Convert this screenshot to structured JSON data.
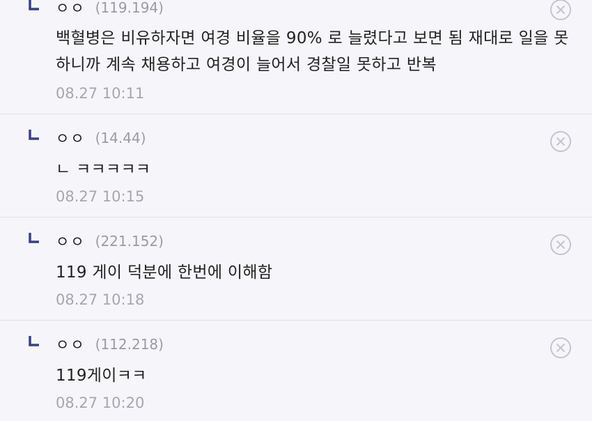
{
  "replies": [
    {
      "nick": "ㅇㅇ",
      "ip": "(119.194)",
      "text": "백혈병은 비유하자면 여경 비율을 90% 로 늘렸다고 보면 됨 재대로 일을 못하니까 계속 채용하고 여경이 늘어서 경찰일 못하고 반복",
      "time": "08.27 10:11"
    },
    {
      "nick": "ㅇㅇ",
      "ip": "(14.44)",
      "text": "ㄴ ㅋㅋㅋㅋㅋ",
      "time": "08.27 10:15"
    },
    {
      "nick": "ㅇㅇ",
      "ip": "(221.152)",
      "text": "119 게이 덕분에 한번에 이해함",
      "time": "08.27 10:18"
    },
    {
      "nick": "ㅇㅇ",
      "ip": "(112.218)",
      "text": "119게이ㅋㅋ",
      "time": "08.27 10:20"
    }
  ],
  "icons": {
    "reply": "reply-arrow-icon",
    "delete": "close-circle-icon"
  },
  "colors": {
    "background": "#f6f6fa",
    "reply_arrow": "#3b3f8f",
    "meta_text": "#a6a6ae",
    "delete_icon": "#c4c4cc"
  }
}
